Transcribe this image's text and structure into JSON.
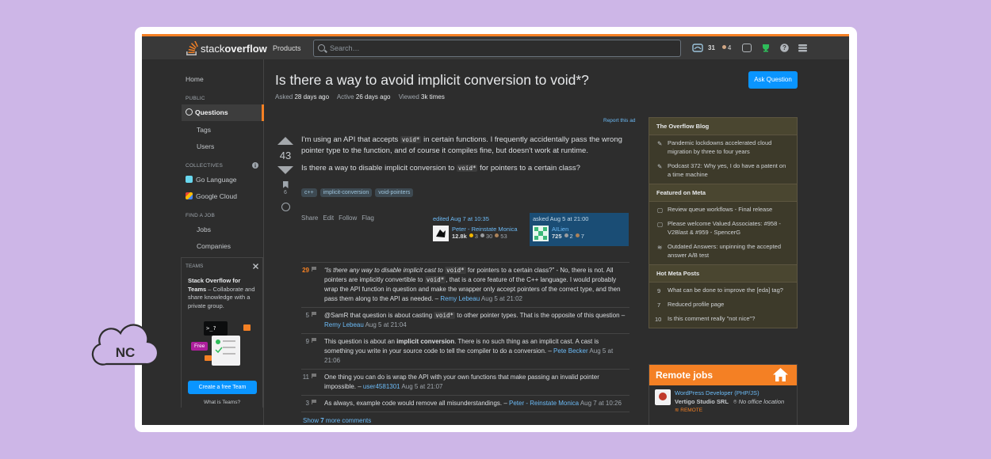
{
  "header": {
    "logo_light": "stack",
    "logo_bold": "overflow",
    "products": "Products",
    "search_placeholder": "Search…",
    "rep": "31",
    "bronze": "4"
  },
  "nav": {
    "home": "Home",
    "public": "PUBLIC",
    "questions": "Questions",
    "tags": "Tags",
    "users": "Users",
    "collectives": "COLLECTIVES",
    "go_language": "Go Language",
    "google_cloud": "Google Cloud",
    "find_a_job": "FIND A JOB",
    "jobs": "Jobs",
    "companies": "Companies",
    "teams": "TEAMS",
    "teams_title": "Stack Overflow for Teams",
    "teams_desc": " – Collaborate and share knowledge with a private group.",
    "free_badge": "Free",
    "create_team": "Create a free Team",
    "what_is_teams": "What is Teams?"
  },
  "question": {
    "title": "Is there a way to avoid implicit conversion to void*?",
    "asked_label": "Asked",
    "asked": "28 days ago",
    "active_label": "Active",
    "active": "26 days ago",
    "viewed_label": "Viewed",
    "viewed": "3k times",
    "ask_button": "Ask Question",
    "report_ad": "Report this ad",
    "score": "43",
    "bookmarks": "6",
    "p1_a": "I'm using an API that accepts ",
    "p1_code": "void*",
    "p1_b": " in certain functions. I frequently accidentally pass the wrong pointer type to the function, and of course it compiles fine, but doesn't work at runtime.",
    "p2_a": "Is there a way to disable implicit conversion to ",
    "p2_code": "void*",
    "p2_b": " for pointers to a certain class?",
    "tags": [
      "c++",
      "implicit-conversion",
      "void-pointers"
    ],
    "menu": [
      "Share",
      "Edit",
      "Follow",
      "Flag"
    ],
    "edited": "edited Aug 7 at 10:35",
    "editor_name": "Peter - Reinstate Monica",
    "editor_rep": "12.8k",
    "editor_gold": "3",
    "editor_silver": "30",
    "editor_bronze": "53",
    "asked_card": "asked Aug 5 at 21:00",
    "asker_name": "AILien",
    "asker_rep": "725",
    "asker_silver": "2",
    "asker_bronze": "7"
  },
  "comments": [
    {
      "score": "29",
      "a": "“Is there any way to disable implicit cast to ",
      "code": "void*",
      "b": " for pointers to a certain class?” - No, there is not. All pointers are implicitly convertible to ",
      "code2": "void*",
      "c": ", that is a core feature of the C++ language. I would probably wrap the API function in question and make the wrapper only accept pointers of the correct type, and then pass them along to the API as needed. – ",
      "user": "Remy Lebeau",
      "date": "Aug 5 at 21:02"
    },
    {
      "score": "5",
      "a": "@SamR that question is about casting ",
      "code": "void*",
      "b": " to other pointer types. That is the opposite of this question – ",
      "user": "Remy Lebeau",
      "date": "Aug 5 at 21:04"
    },
    {
      "score": "9",
      "a": "This question is about an ",
      "bold": "implicit conversion",
      "b": ". There is no such thing as an implicit cast. A cast is something you write in your source code to tell the compiler to do a conversion. – ",
      "user": "Pete Becker",
      "date": "Aug 5 at 21:06"
    },
    {
      "score": "11",
      "a": "One thing you can do is wrap the API with your own functions that make passing an invalid pointer impossible. – ",
      "user": "user4581301",
      "date": "Aug 5 at 21:07"
    },
    {
      "score": "3",
      "a": "As always, example code would remove all misunderstandings. – ",
      "user": "Peter - Reinstate Monica",
      "date": "Aug 7 at 10:26"
    }
  ],
  "show_more": {
    "prefix": "Show ",
    "count": "7",
    "suffix": " more comments"
  },
  "sidebar": {
    "blog_title": "The Overflow Blog",
    "blog_items": [
      "Pandemic lockdowns accelerated cloud migration by three to four years",
      "Podcast 372: Why yes, I do have a patent on a time machine"
    ],
    "meta_title": "Featured on Meta",
    "meta_items": [
      "Review queue workflows - Final release",
      "Please welcome Valued Associates: #958 - V2Blast & #959 - SpencerG",
      "Outdated Answers: unpinning the accepted answer A/B test"
    ],
    "hot_title": "Hot Meta Posts",
    "hot_items": [
      {
        "count": "9",
        "text": "What can be done to improve the [eda] tag?"
      },
      {
        "count": "7",
        "text": "Reduced profile page"
      },
      {
        "count": "10",
        "text": "Is this comment really \"not nice\"?"
      }
    ]
  },
  "remote": {
    "title": "Remote jobs",
    "job_title": "WordPress Developer (PHP/JS)",
    "company": "Vertigo Studio SRL",
    "location": "No office location",
    "remote_label": "REMOTE"
  },
  "overlay": {
    "logo_text": "NC"
  },
  "colors": {
    "accent": "#f48024",
    "link": "#6cbbf7",
    "background": "#cdb6e7",
    "window": "#2d2d2d"
  }
}
